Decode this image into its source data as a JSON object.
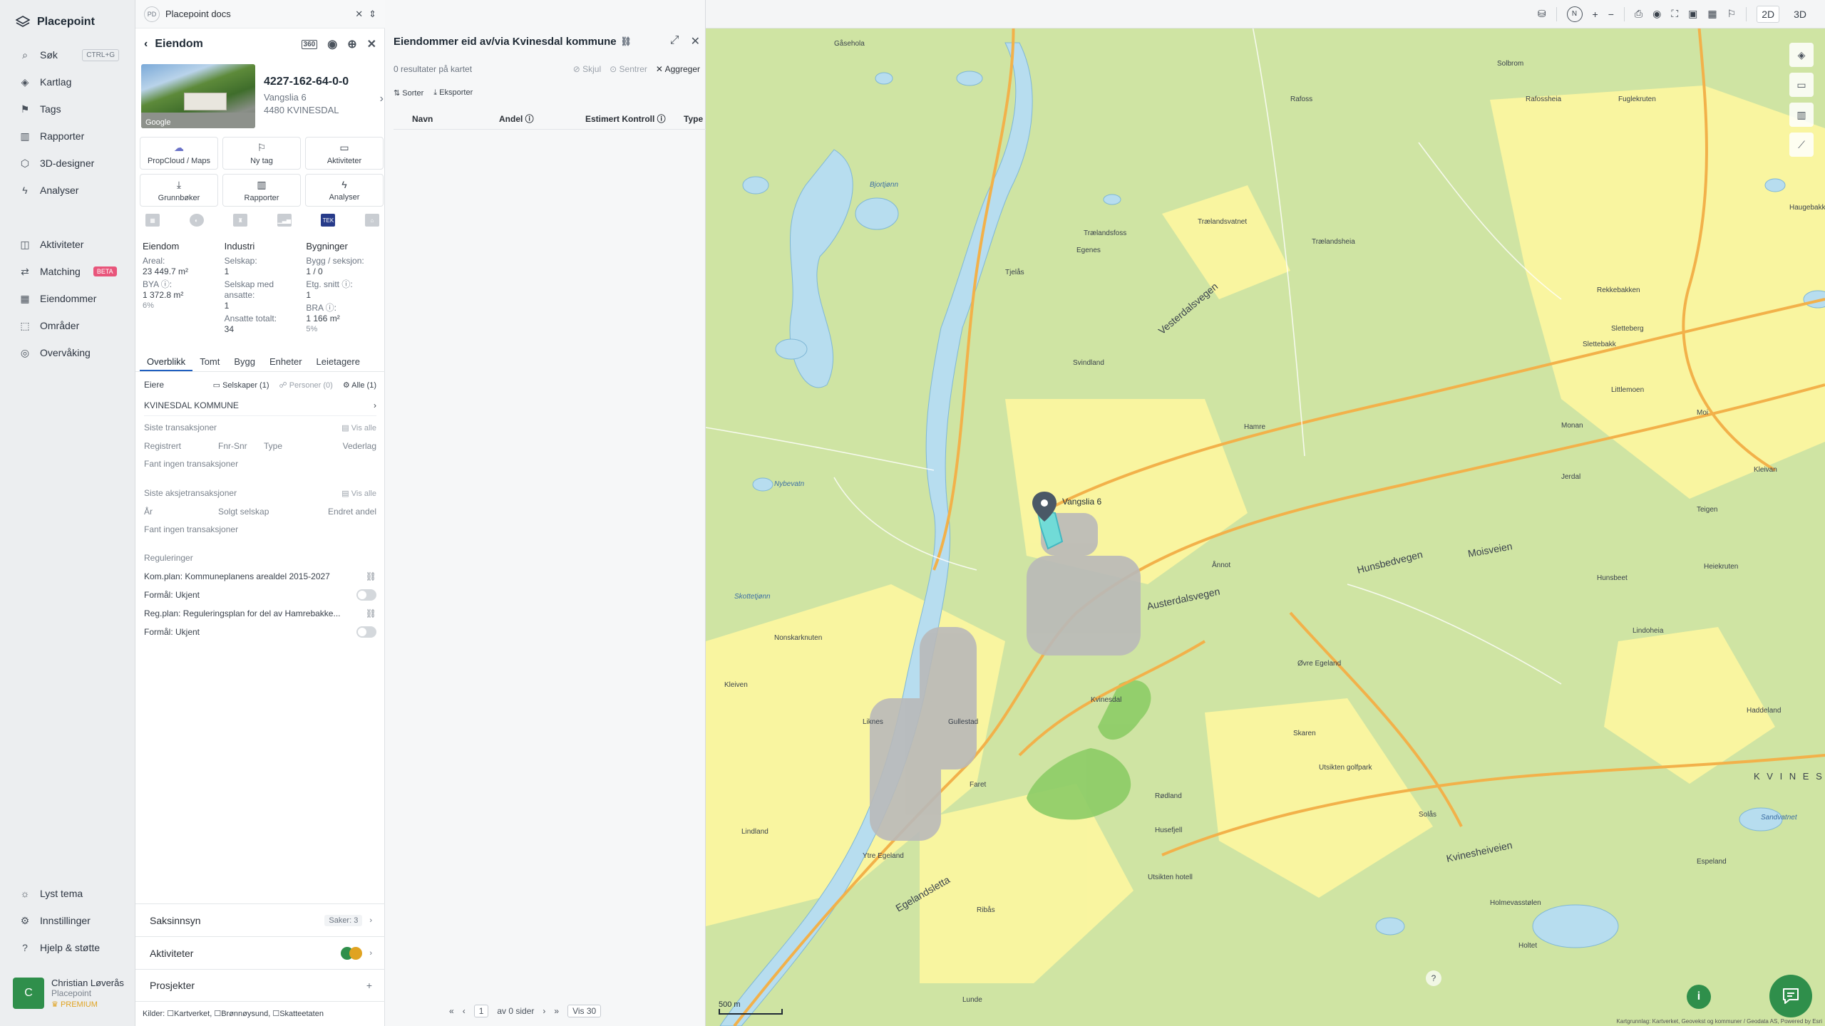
{
  "app": {
    "name": "Placepoint"
  },
  "sidebar": {
    "items": [
      {
        "label": "Søk",
        "shortcut": "CTRL+G"
      },
      {
        "label": "Kartlag"
      },
      {
        "label": "Tags"
      },
      {
        "label": "Rapporter"
      },
      {
        "label": "3D-designer"
      },
      {
        "label": "Analyser"
      },
      {
        "label": "Aktiviteter"
      },
      {
        "label": "Matching",
        "badge": "BETA"
      },
      {
        "label": "Eiendommer"
      },
      {
        "label": "Områder"
      },
      {
        "label": "Overvåking"
      }
    ],
    "bottom": [
      {
        "label": "Lyst tema"
      },
      {
        "label": "Innstillinger"
      },
      {
        "label": "Hjelp & støtte"
      }
    ],
    "user": {
      "initial": "C",
      "name": "Christian Løverås",
      "org": "Placepoint",
      "plan": "PREMIUM"
    }
  },
  "workspace": {
    "badge": "PD",
    "name": "Placepoint docs"
  },
  "property": {
    "header": "Eiendom",
    "id": "4227-162-64-0-0",
    "street": "Vangslia 6",
    "postal": "4480 KVINESDAL",
    "photo_credit": "Google",
    "tiles": [
      {
        "label": "PropCloud / Maps"
      },
      {
        "label": "Ny tag"
      },
      {
        "label": "Aktiviteter"
      },
      {
        "label": "Grunnbøker"
      },
      {
        "label": "Rapporter"
      },
      {
        "label": "Analyser"
      }
    ],
    "tek_badge": "TEK",
    "stats": {
      "eiendom": {
        "title": "Eiendom",
        "areal_label": "Areal:",
        "areal": "23 449.7 m²",
        "bya_label": "BYA ⓘ:",
        "bya": "1 372.8 m²",
        "bya_pct": "6%"
      },
      "industri": {
        "title": "Industri",
        "selskap_label": "Selskap:",
        "selskap": "1",
        "ansatte_label": "Selskap med ansatte:",
        "ansatte": "1",
        "total_label": "Ansatte totalt:",
        "total": "34"
      },
      "bygninger": {
        "title": "Bygninger",
        "bygg_label": "Bygg / seksjon:",
        "bygg": "1 / 0",
        "etg_label": "Etg. snitt ⓘ:",
        "etg": "1",
        "bra_label": "BRA ⓘ:",
        "bra": "1 166 m²",
        "bra_pct": "5%"
      }
    },
    "tabs": [
      "Overblikk",
      "Tomt",
      "Bygg",
      "Enheter",
      "Leietagere"
    ],
    "owners": {
      "label": "Eiere",
      "filters": [
        "Selskaper (1)",
        "Personer (0)",
        "Alle (1)"
      ],
      "owner": "KVINESDAL KOMMUNE"
    },
    "transactions": {
      "title": "Siste transaksjoner",
      "show_all": "Vis alle",
      "cols": [
        "Registrert",
        "Fnr-Snr",
        "Type",
        "Vederlag"
      ],
      "empty": "Fant ingen transaksjoner"
    },
    "share_transactions": {
      "title": "Siste aksjetransaksjoner",
      "show_all": "Vis alle",
      "cols": [
        "År",
        "Solgt selskap",
        "Endret andel"
      ],
      "empty": "Fant ingen transaksjoner"
    },
    "regulations": {
      "title": "Reguleringer",
      "items": [
        {
          "plan": "Kom.plan: Kommuneplanens arealdel 2015-2027",
          "purpose": "Formål: Ukjent"
        },
        {
          "plan": "Reg.plan: Reguleringsplan for del av Hamrebakke...",
          "purpose": "Formål: Ukjent"
        }
      ]
    },
    "accordions": [
      {
        "label": "Saksinnsyn",
        "extra": "Saker: 3"
      },
      {
        "label": "Aktiviteter"
      },
      {
        "label": "Prosjekter",
        "extra": "+"
      }
    ],
    "sources": "Kilder: ☐Kartverket, ☐Brønnøysund, ☐Skatteetaten"
  },
  "list": {
    "title": "Eiendommer eid av/via Kvinesdal kommune",
    "results": "0 resultater på kartet",
    "actions": [
      "Skjul",
      "Sentrer",
      "Aggreger"
    ],
    "tools": [
      "Sorter",
      "Eksporter"
    ],
    "columns": [
      "Navn",
      "Andel ⓘ",
      "Estimert Kontroll ⓘ",
      "Type"
    ],
    "pager": {
      "page": "1",
      "of": "av 0 sider",
      "per_page": "Vis 30"
    }
  },
  "map": {
    "modes": [
      "2D",
      "3D"
    ],
    "scale": "500 m",
    "marker_label": "Vangslia 6",
    "attribution": "Kartgrunnlag: Kartverket, Geovekst og kommuner / Geodata AS, Powered by Esri",
    "places": [
      "Gåsehola",
      "Solbrom",
      "Rafoss",
      "Rafossheia",
      "Fuglekruten",
      "Bjortjønn",
      "Trælandsfoss",
      "Egenes",
      "Trælandsheia",
      "Trælandsvatnet",
      "Tjelås",
      "Svindland",
      "Vesterdalsvegen",
      "Hamre",
      "Vangslia 6",
      "Ånnot",
      "Austerdalsvegen",
      "Hunsbedvegen",
      "Moisveien",
      "Kvinesdal",
      "Gullestad",
      "Nonskarknuten",
      "Kleiven",
      "Øvre Egeland",
      "Skaren",
      "Utsikten golfpark",
      "Faret",
      "Rødland",
      "Husefjell",
      "Lindland",
      "Ytre Egeland",
      "Egelandsletta",
      "Kvinesheiveien",
      "Holmevasstølen",
      "Espeland",
      "Lindoheia",
      "Haddeland",
      "K V I N E S",
      "Heiekruten",
      "Teigen",
      "Hunsbeet",
      "Kleivan",
      "Monan",
      "Jerdal",
      "Littlemoen",
      "Sletteberg",
      "Slettebakk",
      "Moi",
      "Skottetjønn",
      "Nybevatn",
      "Rekkebakken",
      "Solås",
      "Sandvatnet",
      "Utsikten hotell",
      "Ribås",
      "Lunde",
      "Holtet",
      "Haugebakkane",
      "Liknes"
    ]
  },
  "colors": {
    "accent": "#2f8f4b",
    "link": "#1f5fbf",
    "beta": "#e8557b",
    "premium": "#e0a321",
    "water": "#b7ddef",
    "forest": "#c8e29a",
    "farmland": "#fbf6a0"
  }
}
